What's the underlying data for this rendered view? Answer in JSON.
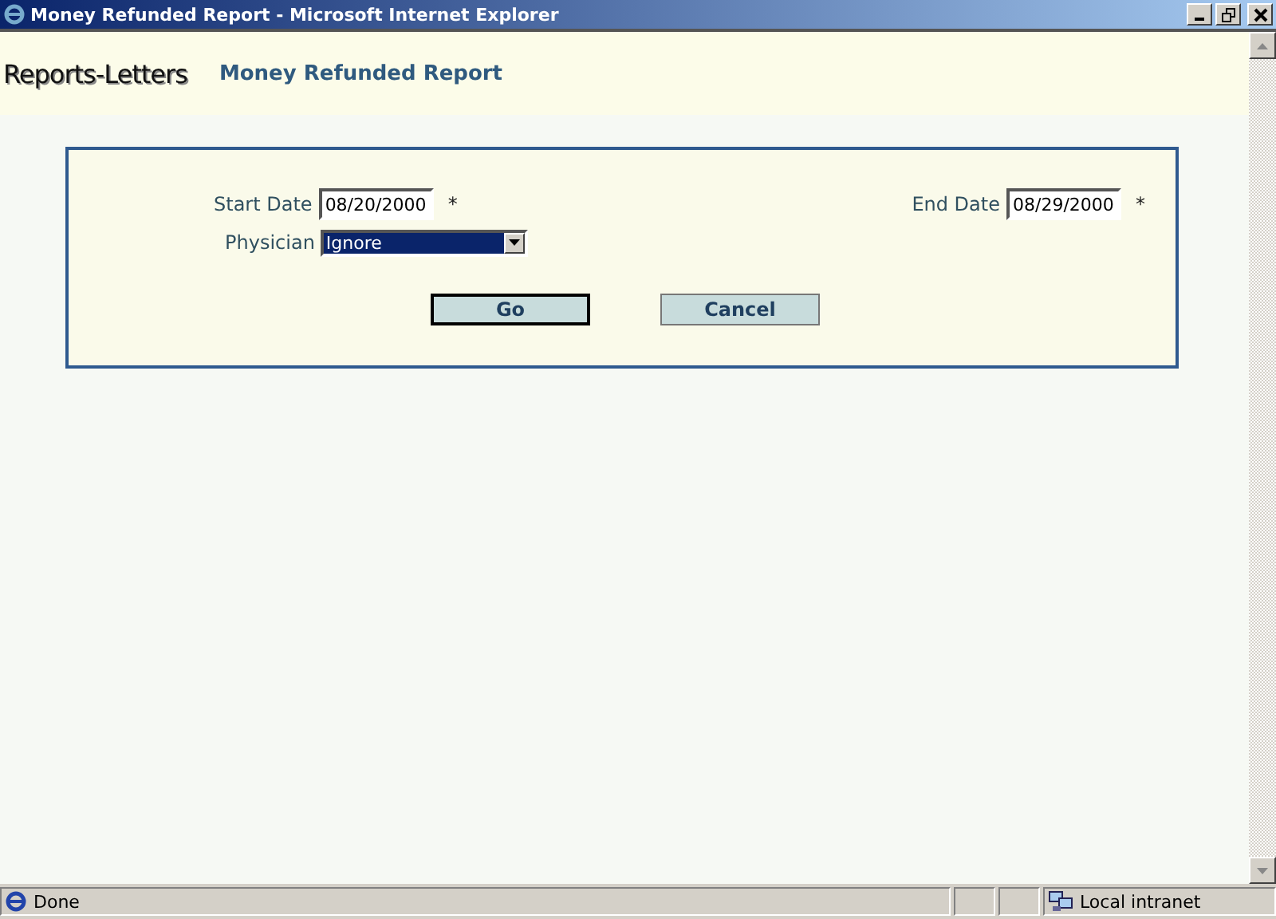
{
  "window": {
    "title": "Money Refunded Report - Microsoft Internet Explorer"
  },
  "header": {
    "section": "Reports-Letters",
    "title": "Money Refunded Report"
  },
  "form": {
    "start_date": {
      "label": "Start Date",
      "value": "08/20/2000",
      "required_mark": "*"
    },
    "end_date": {
      "label": "End Date",
      "value": "08/29/2000",
      "required_mark": "*"
    },
    "physician": {
      "label": "Physician",
      "value": "Ignore",
      "focused": true
    }
  },
  "buttons": [
    {
      "label": "Go",
      "default": true
    },
    {
      "label": "Cancel",
      "default": false
    }
  ],
  "status_bar": {
    "text": "Done",
    "zone": "Local intranet"
  }
}
